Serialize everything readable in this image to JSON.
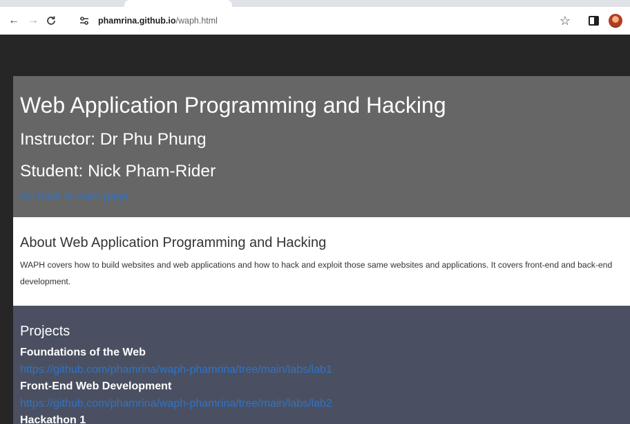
{
  "browser": {
    "url_host": "phamrina.github.io",
    "url_path": "/waph.html",
    "back_icon": "arrow-left-icon",
    "forward_icon": "arrow-right-icon",
    "reload_icon": "reload-icon",
    "site_info_icon": "tune-icon",
    "bookmark_icon": "star-icon",
    "side_panel_icon": "side-panel-icon",
    "profile_icon": "avatar-icon"
  },
  "header": {
    "title": "Web Application Programming and Hacking",
    "instructor": "Instructor: Dr Phu Phung",
    "student": "Student: Nick Pham-Rider",
    "back_link": "Go back to main page"
  },
  "about": {
    "heading": "About Web Application Programming and Hacking",
    "text": "WAPH covers how to build websites and web applications and how to hack and exploit those same websites and applications. It covers front-end and back-end development."
  },
  "projects": {
    "heading": "Projects",
    "items": [
      {
        "title": "Foundations of the Web",
        "link": "https://github.com/phamrina/waph-phamrina/tree/main/labs/lab1"
      },
      {
        "title": "Front-End Web Development",
        "link": "https://github.com/phamrina/waph-phamrina/tree/main/labs/lab2"
      },
      {
        "title": "Hackathon 1",
        "link": ""
      }
    ]
  },
  "colors": {
    "header_bg": "#666666",
    "about_bg": "#ffffff",
    "projects_bg": "#4a5062",
    "link": "#2f73c8",
    "page_bg": "#262626"
  }
}
